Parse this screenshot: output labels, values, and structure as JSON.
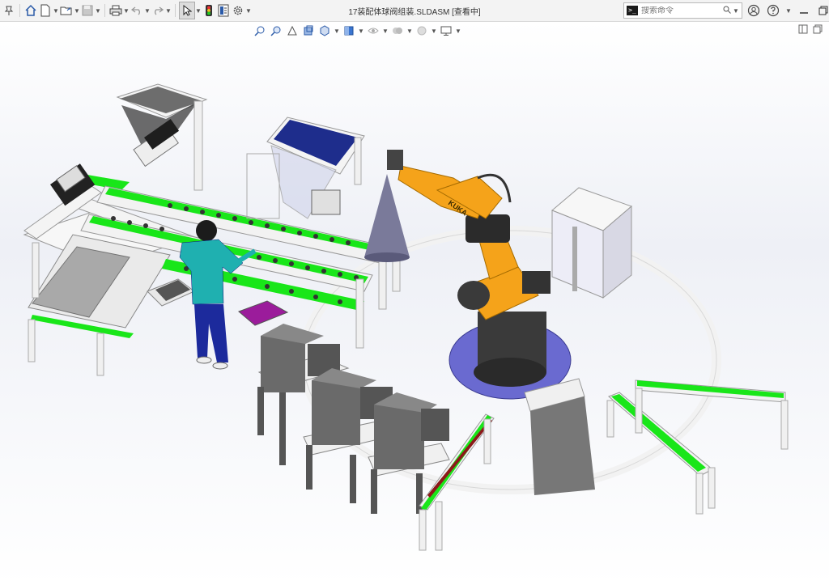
{
  "window": {
    "document_title": "17装配体球阀组装.SLDASM [查看中]"
  },
  "search": {
    "placeholder": "搜索命令"
  },
  "robot": {
    "brand_text": "KUKA"
  },
  "colors": {
    "accent_green": "#19e619",
    "robot_orange": "#f5a31a",
    "base_blue": "#6a6ad0",
    "worker_shirt": "#1fb0b0",
    "worker_pants": "#1c2a9c"
  }
}
